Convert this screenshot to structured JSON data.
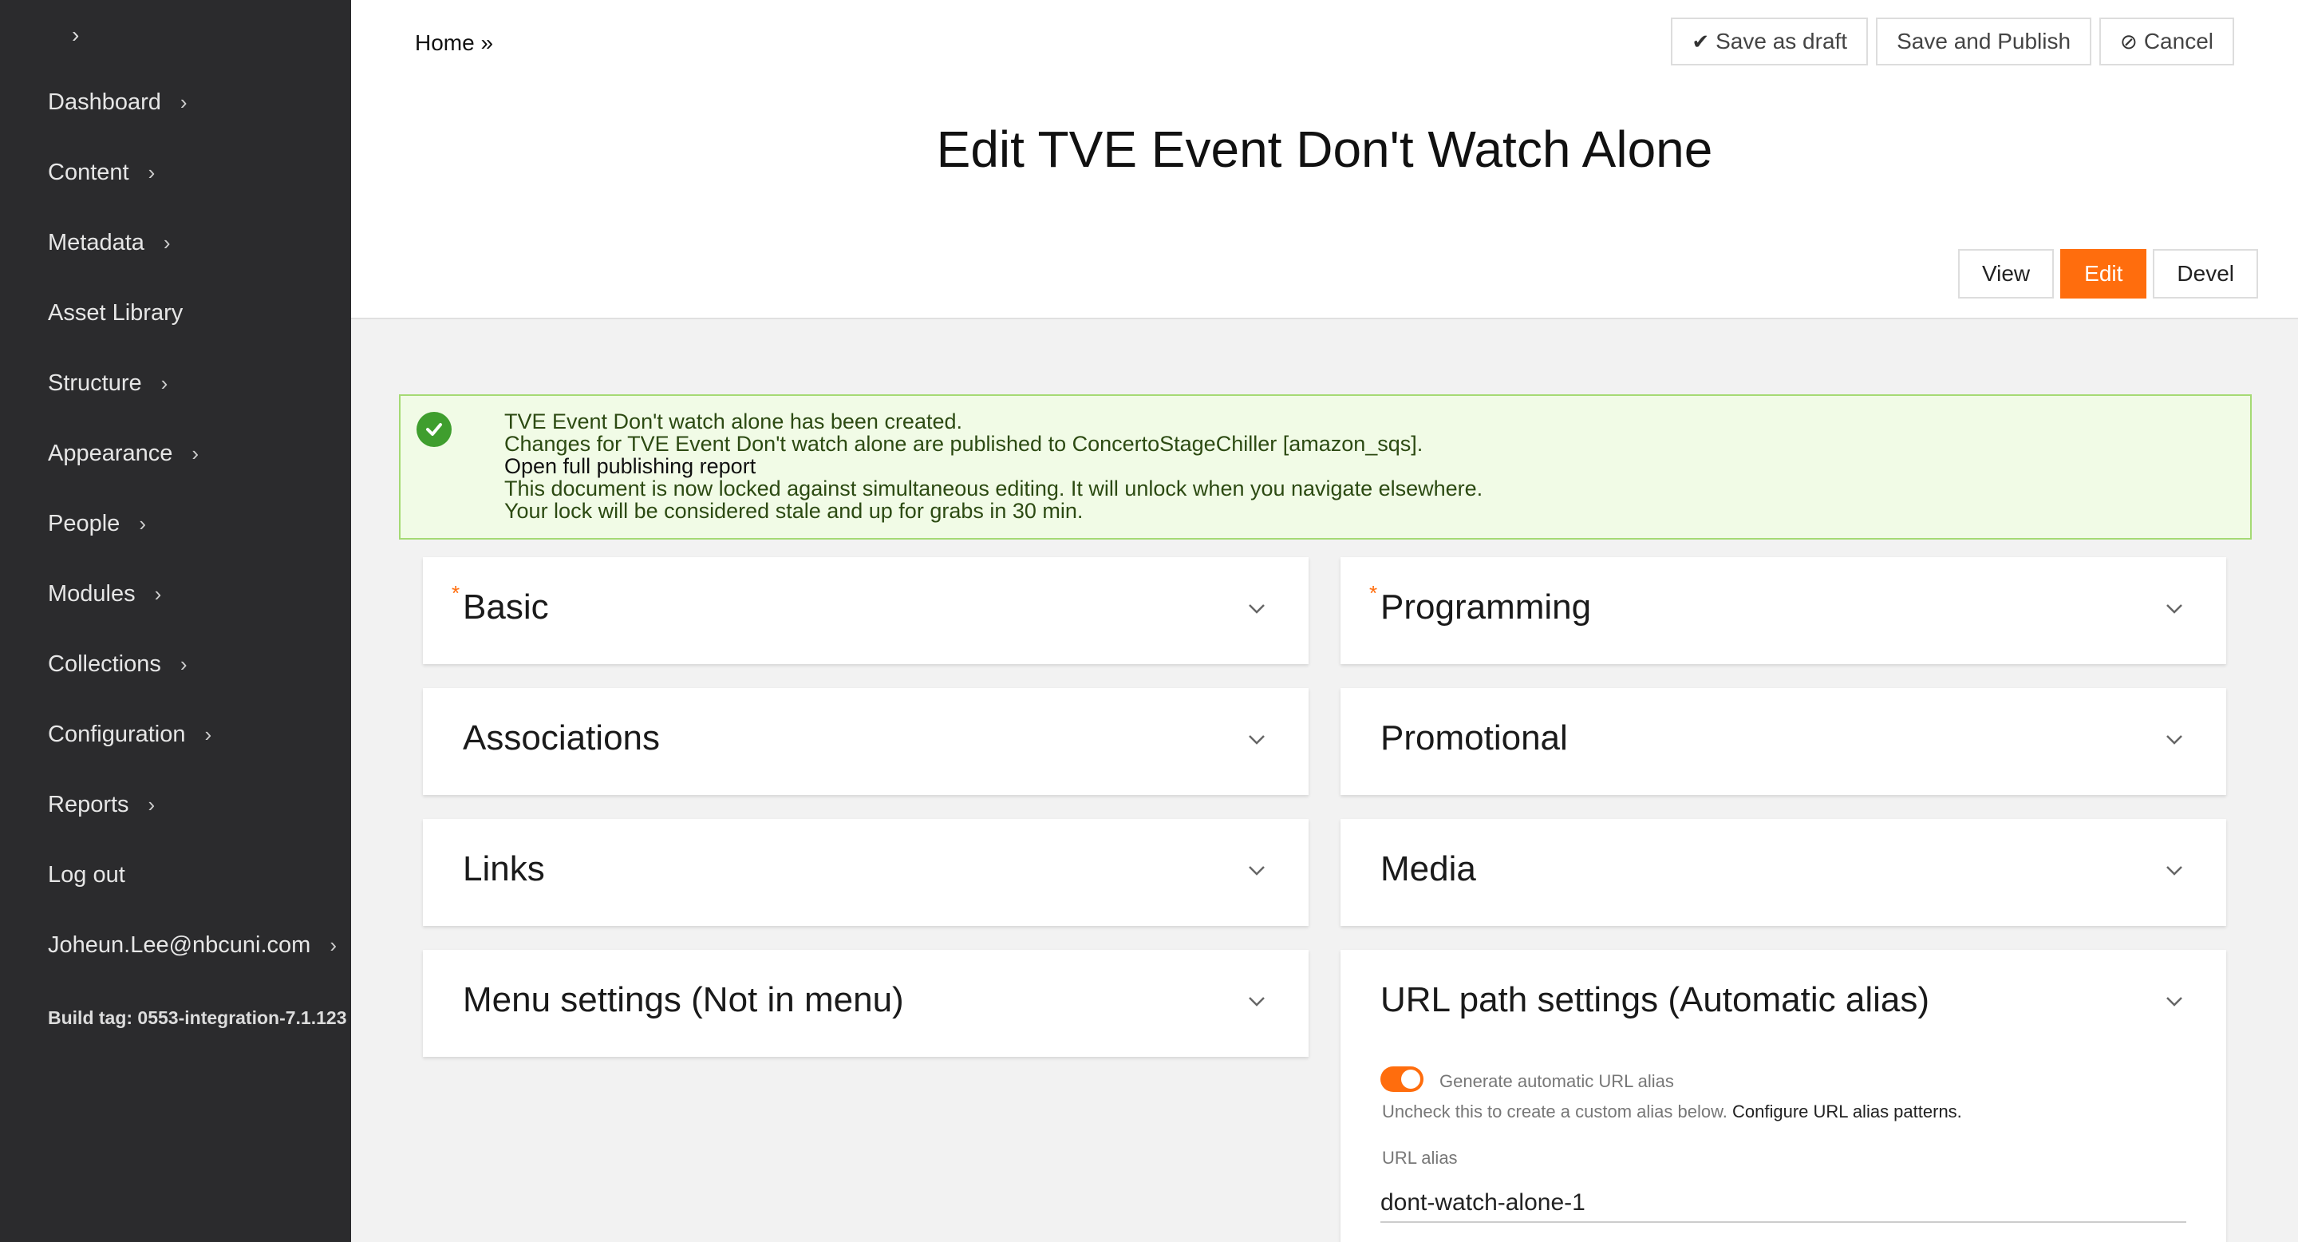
{
  "sidebar": {
    "collapse_glyph": "›",
    "items": [
      {
        "label": "Dashboard",
        "has_children": true
      },
      {
        "label": "Content",
        "has_children": true
      },
      {
        "label": "Metadata",
        "has_children": true
      },
      {
        "label": "Asset Library",
        "has_children": false
      },
      {
        "label": "Structure",
        "has_children": true
      },
      {
        "label": "Appearance",
        "has_children": true
      },
      {
        "label": "People",
        "has_children": true
      },
      {
        "label": "Modules",
        "has_children": true
      },
      {
        "label": "Collections",
        "has_children": true
      },
      {
        "label": "Configuration",
        "has_children": true
      },
      {
        "label": "Reports",
        "has_children": true
      },
      {
        "label": "Log out",
        "has_children": false
      },
      {
        "label": "Joheun.Lee@nbcuni.com",
        "has_children": true
      }
    ],
    "build_tag": "Build tag: 0553-integration-7.1.123"
  },
  "header": {
    "breadcrumb": "Home »",
    "actions": {
      "save_draft": "Save as draft",
      "save_publish": "Save and Publish",
      "cancel": "Cancel"
    },
    "title": "Edit TVE Event Don't Watch Alone",
    "tabs": {
      "view": "View",
      "edit": "Edit",
      "devel": "Devel"
    }
  },
  "message": {
    "line1": "TVE Event Don't watch alone has been created.",
    "line2": "Changes for TVE Event Don't watch alone are published to ConcertoStageChiller [amazon_sqs].",
    "line3": "Open full publishing report",
    "line4": "This document is now locked against simultaneous editing. It will unlock when you navigate elsewhere.",
    "line5": "Your lock will be considered stale and up for grabs in 30 min."
  },
  "sections": {
    "basic": "Basic",
    "programming": "Programming",
    "associations": "Associations",
    "promotional": "Promotional",
    "links": "Links",
    "media": "Media",
    "menu_settings": "Menu settings (Not in menu)",
    "url_path_settings": "URL path settings (Automatic alias)"
  },
  "url_settings": {
    "toggle_label": "Generate automatic URL alias",
    "toggle_on": true,
    "help_text": "Uncheck this to create a custom alias below.",
    "help_link": "Configure URL alias patterns.",
    "alias_label": "URL alias",
    "alias_value": "dont-watch-alone-1"
  },
  "colors": {
    "accent": "#ff6d0d",
    "sidebar_bg": "#2b2b2d",
    "success_bg": "#f1fbe6",
    "success_border": "#a5da74"
  }
}
